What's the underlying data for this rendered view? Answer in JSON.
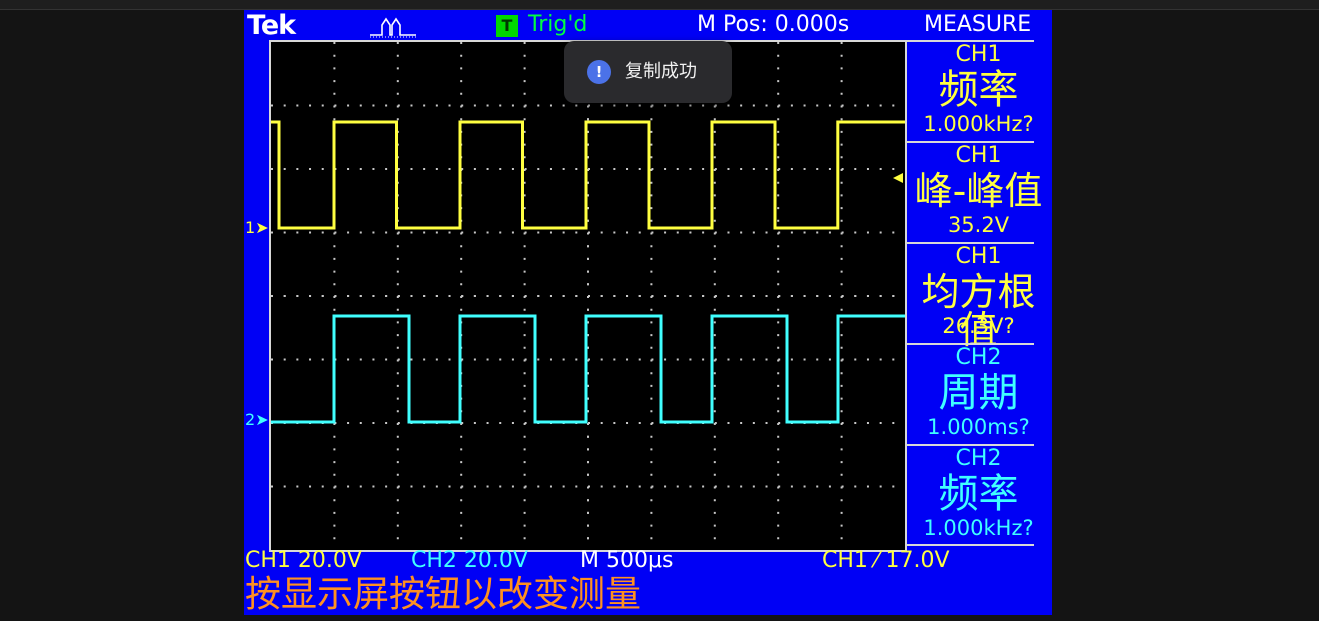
{
  "header": {
    "brand": "Tek",
    "acquisition_icon": "pulse-acquire-icon",
    "trigger_badge": "T",
    "trigger_status": "Trig'd",
    "main_position": "M Pos: 0.000s",
    "menu_title": "MEASURE"
  },
  "markers": {
    "ch1": "1",
    "ch2": "2"
  },
  "measurements": [
    {
      "source": "CH1",
      "name": "频率",
      "value": "1.000kHz?",
      "color": "#ffff40"
    },
    {
      "source": "CH1",
      "name": "峰-峰值",
      "value": "35.2V",
      "color": "#ffff40"
    },
    {
      "source": "CH1",
      "name": "均方根值",
      "value": "26.3V?",
      "color": "#ffff40"
    },
    {
      "source": "CH2",
      "name": "周期",
      "value": "1.000ms?",
      "color": "#40ffff"
    },
    {
      "source": "CH2",
      "name": "频率",
      "value": "1.000kHz?",
      "color": "#40ffff"
    }
  ],
  "status": {
    "ch1_scale": "CH1  20.0V",
    "ch2_scale": "CH2  20.0V",
    "timebase": "M 500μs",
    "trigger": "CH1 ⁄ 17.0V"
  },
  "message": "按显示屏按钮以改变测量",
  "toast": {
    "icon": "info-icon",
    "text": "复制成功"
  },
  "colors": {
    "frame": "#0000f5",
    "ch1": "#ffff40",
    "ch2": "#40ffff",
    "message": "#ff9020"
  }
}
